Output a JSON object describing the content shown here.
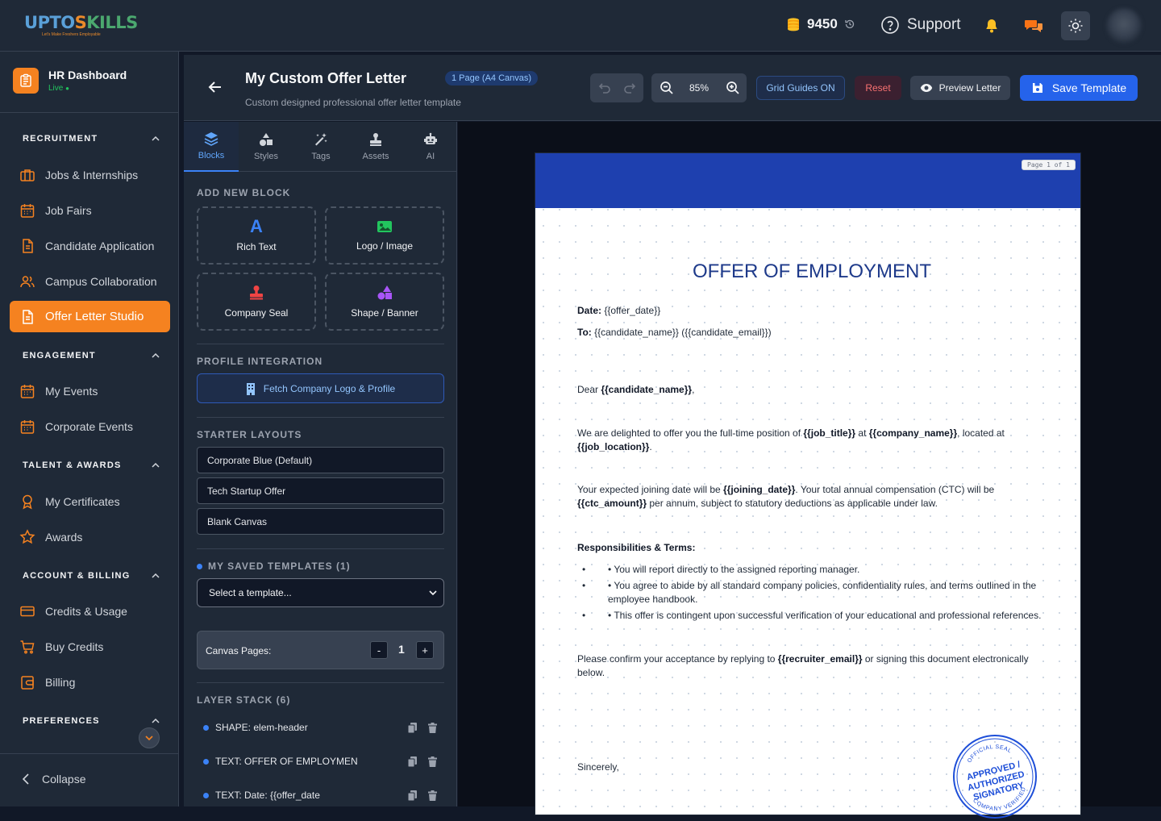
{
  "topbar": {
    "logo_main": "UptoSkills",
    "logo_tagline": "Let's Make Freshers Employable",
    "credits": "9450",
    "support": "Support"
  },
  "sidebar": {
    "brand_title": "HR Dashboard",
    "brand_status": "Live",
    "sections": {
      "recruitment": "RECRUITMENT",
      "engagement": "ENGAGEMENT",
      "talent": "TALENT & AWARDS",
      "account": "ACCOUNT & BILLING",
      "preferences": "PREFERENCES"
    },
    "items": {
      "jobs": "Jobs & Internships",
      "job_fairs": "Job Fairs",
      "candidate_application": "Candidate Application",
      "campus": "Campus Collaboration",
      "offer_letter": "Offer Letter Studio",
      "my_events": "My Events",
      "corporate_events": "Corporate Events",
      "certificates": "My Certificates",
      "awards": "Awards",
      "credits_usage": "Credits & Usage",
      "buy_credits": "Buy Credits",
      "billing": "Billing"
    },
    "collapse": "Collapse"
  },
  "editor": {
    "title": "My Custom Offer Letter",
    "subtitle": "Custom designed professional offer letter template",
    "page_badge": "1 Page (A4 Canvas)",
    "zoom": "85%",
    "grid_guides": "Grid Guides ON",
    "reset": "Reset",
    "preview": "Preview Letter",
    "save": "Save Template"
  },
  "panel": {
    "tabs": [
      "Blocks",
      "Styles",
      "Tags",
      "Assets",
      "AI"
    ],
    "add_new_block": "ADD NEW BLOCK",
    "blocks": [
      "Rich Text",
      "Logo / Image",
      "Company Seal",
      "Shape / Banner"
    ],
    "profile_integration": "PROFILE INTEGRATION",
    "fetch_button": "Fetch Company Logo & Profile",
    "starter_layouts": "STARTER LAYOUTS",
    "layouts": [
      "Corporate Blue (Default)",
      "Tech Startup Offer",
      "Blank Canvas"
    ],
    "saved_templates": "MY SAVED TEMPLATES (1)",
    "template_select": "Select a template...",
    "canvas_pages_label": "Canvas Pages:",
    "canvas_pages_value": "1",
    "minus": "-",
    "plus": "+",
    "layer_stack": "LAYER STACK (6)",
    "layers": [
      "SHAPE: elem-header",
      "TEXT: OFFER OF EMPLOYMEN",
      "TEXT: Date: {{offer_date"
    ]
  },
  "letter": {
    "page_indicator": "Page 1 of 1",
    "heading": "OFFER OF EMPLOYMENT",
    "date_label": "Date:",
    "date_value": " {{offer_date}}",
    "to_label": "To:",
    "to_value": " {{candidate_name}} ({{candidate_email}})",
    "dear": "Dear ",
    "dear_name": "{{candidate_name}}",
    "dear_end": ",",
    "p1_a": "We are delighted to offer you the full-time position of ",
    "p1_job": "{{job_title}}",
    "p1_b": " at ",
    "p1_company": "{{company_name}}",
    "p1_c": ", located at",
    "p1_location": "{{job_location}}",
    "p1_d": ".",
    "p2_a": "Your expected joining date will be ",
    "p2_date": "{{joining_date}}",
    "p2_b": ". Your total annual compensation (CTC) will be",
    "p2_ctc": "{{ctc_amount}}",
    "p2_c": " per annum, subject to statutory deductions as applicable under law.",
    "resp_heading": "Responsibilities & Terms:",
    "bullets": [
      "• You will report directly to the assigned reporting manager.",
      "• You agree to abide by all standard company policies, confidentiality rules, and terms outlined in the",
      "employee handbook.",
      "• This offer is contingent upon successful verification of your educational and professional references."
    ],
    "p3_a": "Please confirm your acceptance by replying to ",
    "p3_email": "{{recruiter_email}}",
    "p3_b": " or signing this document electronically",
    "p3_c": "below.",
    "sincerely": "Sincerely,",
    "seal_top": "OFFICIAL SEAL",
    "seal_l1": "APPROVED /",
    "seal_l2": "AUTHORIZED",
    "seal_l3": "SIGNATORY",
    "seal_bottom": "COMPANY VERIFIED"
  },
  "colors": {
    "accent": "#f58220",
    "primary_blue": "#2563eb",
    "letter_band": "#1e40af"
  }
}
